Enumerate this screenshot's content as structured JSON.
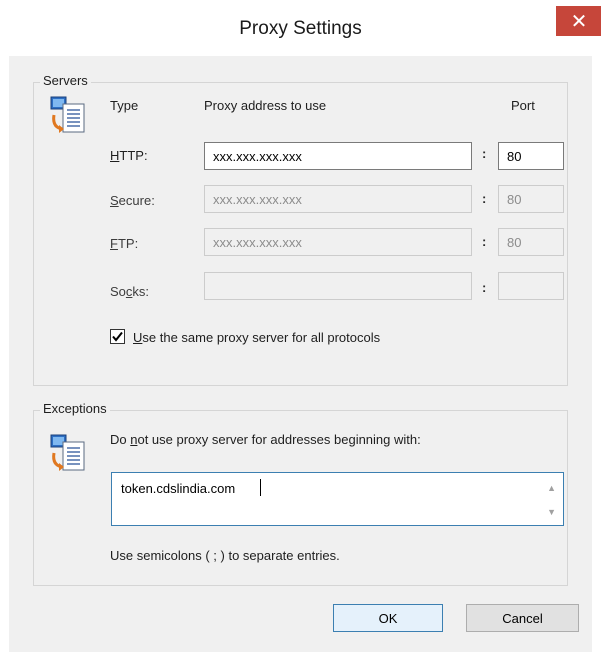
{
  "window": {
    "title": "Proxy Settings",
    "close_glyph": "✕"
  },
  "servers": {
    "legend": "Servers",
    "icon": "network-computer-icon",
    "headers": {
      "type": "Type",
      "address": "Proxy address to use",
      "port": "Port"
    },
    "rows": [
      {
        "label_pre": "",
        "label_key": "H",
        "label_post": "TTP:",
        "address": "xxx.xxx.xxx.xxx",
        "port": "80",
        "enabled": true
      },
      {
        "label_pre": "",
        "label_key": "S",
        "label_post": "ecure:",
        "address": "xxx.xxx.xxx.xxx",
        "port": "80",
        "enabled": false
      },
      {
        "label_pre": "",
        "label_key": "F",
        "label_post": "TP:",
        "address": "xxx.xxx.xxx.xxx",
        "port": "80",
        "enabled": false
      },
      {
        "label_pre": "So",
        "label_key": "c",
        "label_post": "ks:",
        "address": "",
        "port": "",
        "enabled": false
      }
    ],
    "colon": ":",
    "same_proxy": {
      "checked": true,
      "label_key": "U",
      "label_post": "se the same proxy server for all protocols"
    }
  },
  "exceptions": {
    "legend": "Exceptions",
    "icon": "network-computer-icon",
    "prompt_pre": "Do ",
    "prompt_key": "n",
    "prompt_post": "ot use proxy server for addresses beginning with:",
    "value": "token.cdslindia.com",
    "hint": "Use semicolons ( ; ) to separate entries."
  },
  "buttons": {
    "ok": "OK",
    "cancel": "Cancel"
  },
  "colors": {
    "close": "#c6463a",
    "client": "#f0f0f0",
    "focus_border": "#3c7fb1"
  }
}
